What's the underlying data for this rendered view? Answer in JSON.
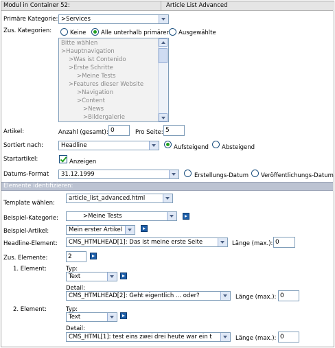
{
  "header": {
    "left_title": "Modul in Container 52:",
    "right_title": "Article List Advanced"
  },
  "primary_category": {
    "label": "Primäre Kategorie:",
    "value": ">Services"
  },
  "additional_categories": {
    "label": "Zus. Kategorien:",
    "options": [
      "Keine",
      "Alle unterhalb primärer",
      "Ausgewählte"
    ],
    "selected": "Alle unterhalb primärer",
    "list": [
      "Bitte wählen",
      ">Hauptnavigation",
      ">Was ist Contenido",
      ">Erste Schritte",
      ">Meine Tests",
      ">Features dieser Website",
      ">Navigation",
      ">Content",
      ">News",
      ">Bildergalerie"
    ]
  },
  "articles": {
    "label": "Artikel:",
    "total_label": "Anzahl (gesamt):",
    "total_value": "0",
    "per_page_label": "Pro Seite:",
    "per_page_value": "5"
  },
  "sort": {
    "label": "Sortiert nach:",
    "value": "Headline",
    "options": [
      "Aufsteigend",
      "Absteigend"
    ],
    "selected": "Aufsteigend"
  },
  "start_article": {
    "label": "Startartikel:",
    "checkbox_label": "Anzeigen",
    "checked": true
  },
  "date_format": {
    "label": "Datums-Format",
    "value": "31.12.1999",
    "options": [
      "Erstellungs-Datum",
      "Veröffentlichungs-Datum"
    ]
  },
  "identify": {
    "title": "Elemente identifizieren:",
    "template_label": "Template wählen:",
    "template_value": "article_list_advanced.html",
    "example_category_label": "Beispiel-Kategorie:",
    "example_category_value": ">Meine Tests",
    "example_article_label": "Beispiel-Artikel:",
    "example_article_value": "Mein erster Artikel",
    "headline_label": "Headline-Element:",
    "headline_value": "CMS_HTMLHEAD[1]:  Das ist meine erste Seite",
    "length_label": "Länge (max.):",
    "headline_length": "0",
    "extra_label": "Zus. Elemente:",
    "extra_value": "2"
  },
  "elements": [
    {
      "label": "1. Element:",
      "type_label": "Typ:",
      "type_value": "Text",
      "detail_label": "Detail:",
      "detail_value": "CMS_HTMLHEAD[2]:  Geht eigentlich ... oder?",
      "length_label": "Länge (max.):",
      "length_value": "0"
    },
    {
      "label": "2. Element:",
      "type_label": "Typ:",
      "type_value": "Text",
      "detail_label": "Detail:",
      "detail_value": "CMS_HTML[1]:  test eins zwei drei    heute war ein t",
      "length_label": "Länge (max.):",
      "length_value": "0"
    }
  ]
}
